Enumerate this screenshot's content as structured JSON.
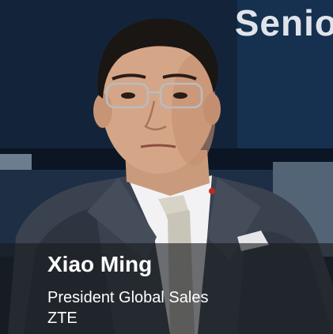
{
  "speaker": {
    "name": "Xiao Ming",
    "title": "President Global Sales",
    "company": "ZTE"
  },
  "backdrop": {
    "partial_text": "Senio"
  },
  "colors": {
    "background": "#0e1a2a",
    "caption_overlay": "#191b1e",
    "text": "#ffffff",
    "suit": "#3a4250",
    "shirt": "#f2f2f4"
  }
}
